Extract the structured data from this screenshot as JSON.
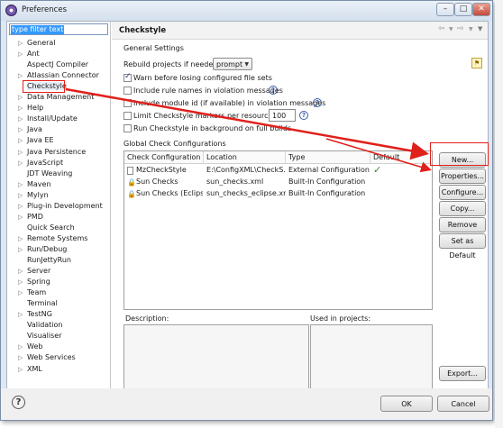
{
  "window": {
    "title": "Preferences"
  },
  "sidebar": {
    "filter_text": "type filter text",
    "items": [
      {
        "label": "General",
        "expandable": true
      },
      {
        "label": "Ant",
        "expandable": true
      },
      {
        "label": "AspectJ Compiler",
        "expandable": false
      },
      {
        "label": "Atlassian Connector",
        "expandable": true
      },
      {
        "label": "Checkstyle",
        "expandable": false,
        "selected": true
      },
      {
        "label": "Data Management",
        "expandable": true
      },
      {
        "label": "Help",
        "expandable": true
      },
      {
        "label": "Install/Update",
        "expandable": true
      },
      {
        "label": "Java",
        "expandable": true
      },
      {
        "label": "Java EE",
        "expandable": true
      },
      {
        "label": "Java Persistence",
        "expandable": true
      },
      {
        "label": "JavaScript",
        "expandable": true
      },
      {
        "label": "JDT Weaving",
        "expandable": false
      },
      {
        "label": "Maven",
        "expandable": true
      },
      {
        "label": "Mylyn",
        "expandable": true
      },
      {
        "label": "Plug-in Development",
        "expandable": true
      },
      {
        "label": "PMD",
        "expandable": true
      },
      {
        "label": "Quick Search",
        "expandable": false
      },
      {
        "label": "Remote Systems",
        "expandable": true
      },
      {
        "label": "Run/Debug",
        "expandable": true
      },
      {
        "label": "RunJettyRun",
        "expandable": false
      },
      {
        "label": "Server",
        "expandable": true
      },
      {
        "label": "Spring",
        "expandable": true
      },
      {
        "label": "Team",
        "expandable": true
      },
      {
        "label": "Terminal",
        "expandable": false
      },
      {
        "label": "TestNG",
        "expandable": true
      },
      {
        "label": "Validation",
        "expandable": false
      },
      {
        "label": "Visualiser",
        "expandable": false
      },
      {
        "label": "Web",
        "expandable": true
      },
      {
        "label": "Web Services",
        "expandable": true
      },
      {
        "label": "XML",
        "expandable": true
      }
    ]
  },
  "page": {
    "title": "Checkstyle",
    "general_settings": "General Settings",
    "rebuild_label": "Rebuild projects if needed:",
    "rebuild_value": "prompt",
    "options": {
      "warn": "Warn before losing configured file sets",
      "rule_names": "Include rule names in violation messages",
      "module_id": "Include module id (if available) in violation messages",
      "limit": "Limit Checkstyle markers per resource to",
      "background": "Run Checkstyle in background on full builds"
    },
    "limit_value": "100",
    "global_configs": "Global Check Configurations",
    "table": {
      "headers": [
        "Check Configuration",
        "Location",
        "Type",
        "Default"
      ],
      "rows": [
        {
          "name": "MzCheckStyle",
          "location": "E:\\ConfigXML\\CheckS...",
          "type": "External Configuration...",
          "default": "✓",
          "icon": "file-icon"
        },
        {
          "name": "Sun Checks",
          "location": "sun_checks.xml",
          "type": "Built-In Configuration",
          "default": "",
          "icon": "lock-icon"
        },
        {
          "name": "Sun Checks (Eclipse)",
          "location": "sun_checks_eclipse.xml",
          "type": "Built-In Configuration",
          "default": "",
          "icon": "lock-icon"
        }
      ]
    },
    "buttons": {
      "new": "New...",
      "properties": "Properties...",
      "configure": "Configure...",
      "copy": "Copy...",
      "remove": "Remove",
      "set_default": "Set as Default",
      "export": "Export..."
    },
    "description_label": "Description:",
    "used_in_label": "Used in projects:"
  },
  "footer": {
    "ok": "OK",
    "cancel": "Cancel"
  },
  "accent_colors": {
    "annotation_red": "#e0201a",
    "selection_blue": "#3399ff",
    "check_green": "#2e8b2e"
  }
}
